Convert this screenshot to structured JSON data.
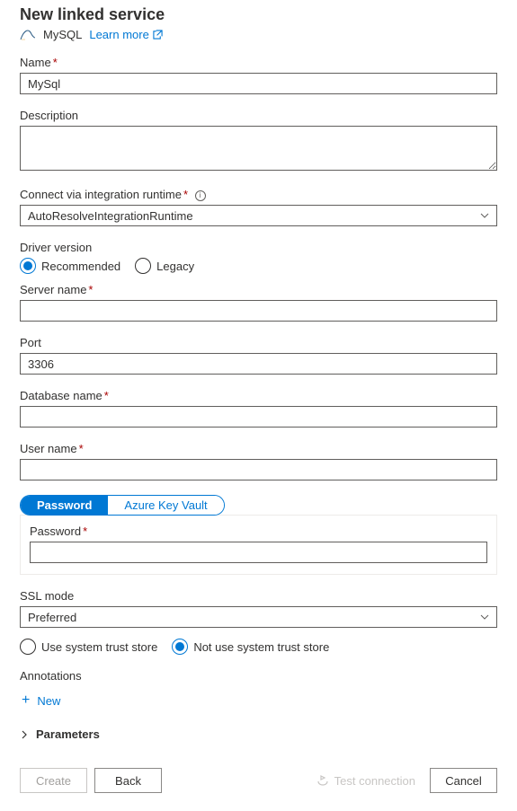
{
  "header": {
    "title": "New linked service",
    "service": "MySQL",
    "learn_more": "Learn more"
  },
  "form": {
    "name_label": "Name",
    "name_value": "MySql",
    "description_label": "Description",
    "description_value": "",
    "runtime_label": "Connect via integration runtime",
    "runtime_value": "AutoResolveIntegrationRuntime",
    "driver_label": "Driver version",
    "driver_options": {
      "recommended": "Recommended",
      "legacy": "Legacy"
    },
    "driver_selected": "recommended",
    "server_label": "Server name",
    "server_value": "",
    "port_label": "Port",
    "port_value": "3306",
    "database_label": "Database name",
    "database_value": "",
    "username_label": "User name",
    "username_value": "",
    "cred_tabs": {
      "password": "Password",
      "akv": "Azure Key Vault"
    },
    "cred_selected": "password",
    "password_label": "Password",
    "password_value": "",
    "ssl_label": "SSL mode",
    "ssl_value": "Preferred",
    "trust_options": {
      "use": "Use system trust store",
      "notuse": "Not use system trust store"
    },
    "trust_selected": "notuse",
    "annotations_label": "Annotations",
    "new_label": "New",
    "parameters_label": "Parameters"
  },
  "footer": {
    "create": "Create",
    "back": "Back",
    "test": "Test connection",
    "cancel": "Cancel"
  }
}
